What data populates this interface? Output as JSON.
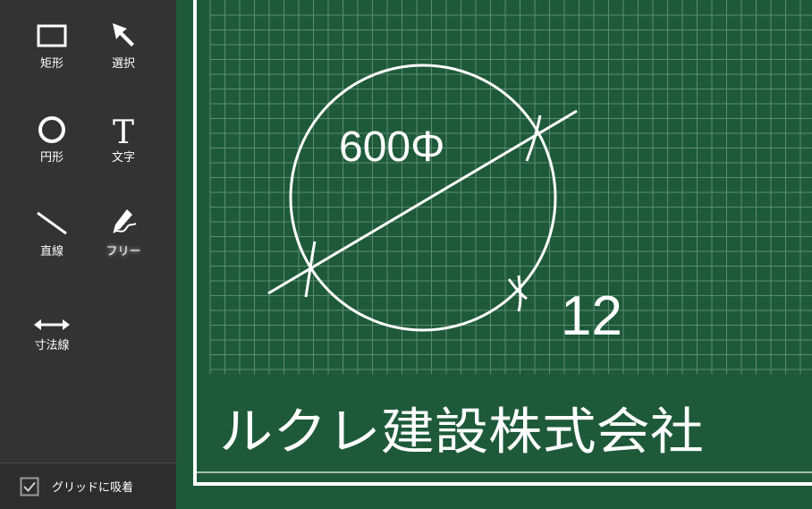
{
  "toolbar": {
    "tools": [
      {
        "id": "rect",
        "label": "矩形",
        "icon": "rectangle-icon"
      },
      {
        "id": "select",
        "label": "選択",
        "icon": "arrow-pointer-icon"
      },
      {
        "id": "circle",
        "label": "円形",
        "icon": "circle-icon"
      },
      {
        "id": "text",
        "label": "文字",
        "icon": "text-t-icon"
      },
      {
        "id": "line",
        "label": "直線",
        "icon": "line-icon"
      },
      {
        "id": "free",
        "label": "フリー",
        "icon": "pen-icon"
      },
      {
        "id": "dimension",
        "label": "寸法線",
        "icon": "double-arrow-icon"
      }
    ]
  },
  "snap": {
    "label": "グリッドに吸着",
    "checked": true
  },
  "board": {
    "dimension_text": "600Φ",
    "number_text": "12",
    "company_text": "ルクレ建設株式会社"
  },
  "colors": {
    "board": "#1e5a3a",
    "sidebar": "#333333",
    "chalk": "#ffffff"
  }
}
